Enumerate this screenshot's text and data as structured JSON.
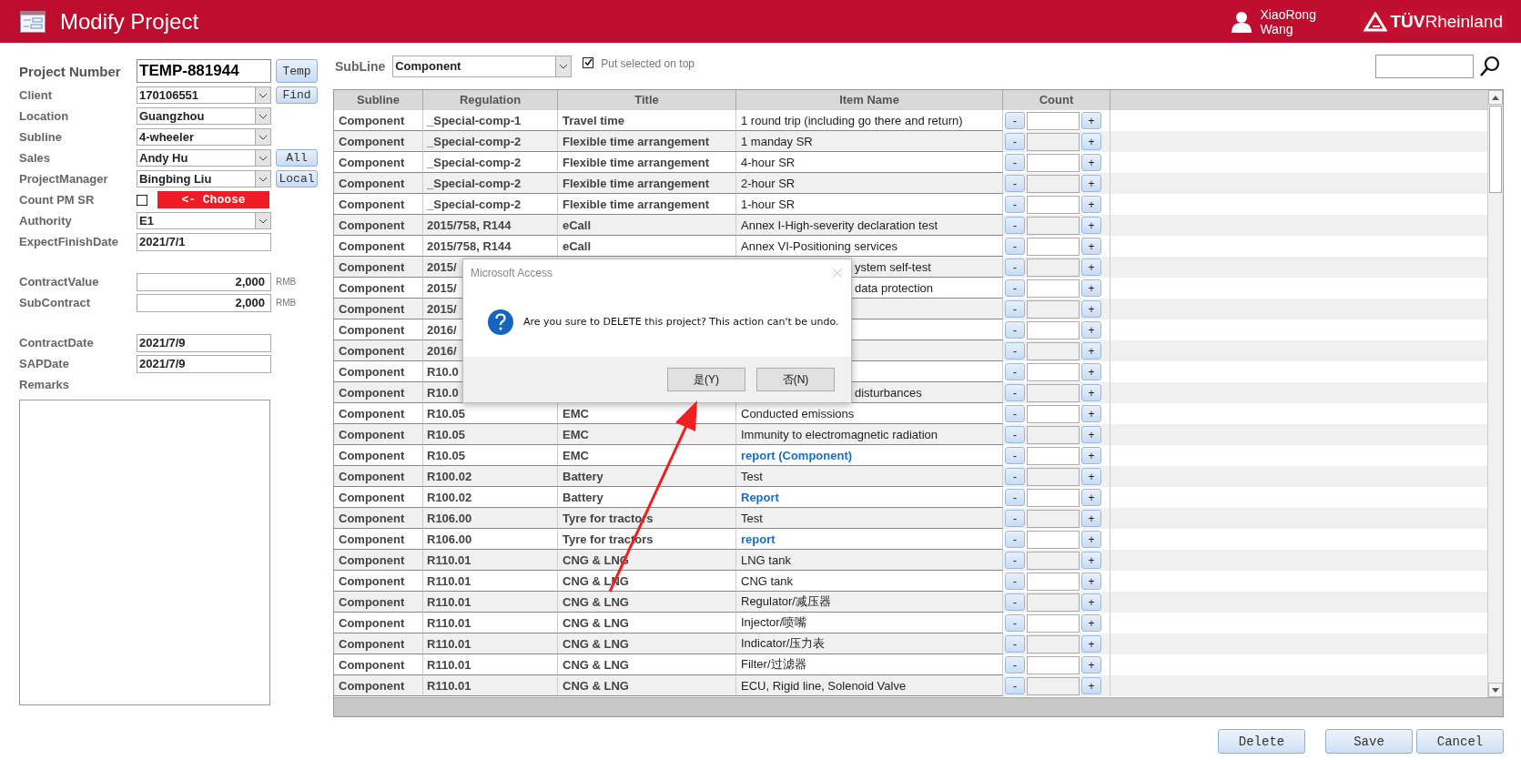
{
  "window": {
    "title": "Modify Project"
  },
  "user": {
    "name": "XiaoRong Wang"
  },
  "logo": {
    "text": "**TÜV**Rheinland"
  },
  "form": {
    "groups": [
      [
        {
          "label": "Project Number",
          "kind": "big",
          "value": "TEMP-881944",
          "button": {
            "label": "Temp",
            "kind": "plain"
          }
        },
        {
          "label": "Client",
          "kind": "combo",
          "value": "170106551",
          "button": {
            "label": "Find",
            "kind": "plain"
          }
        },
        {
          "label": "Location",
          "kind": "combo",
          "value": "Guangzhou"
        },
        {
          "label": "Subline",
          "kind": "combo",
          "value": "4-wheeler"
        },
        {
          "label": "Sales",
          "kind": "combo",
          "value": "Andy Hu",
          "button": {
            "label": "All",
            "kind": "plain"
          }
        },
        {
          "label": "ProjectManager",
          "kind": "combo",
          "value": "Bingbing Liu",
          "button": {
            "label": "Local",
            "kind": "plain"
          }
        },
        {
          "label": "Count PM SR",
          "kind": "checkbox",
          "checked": false,
          "button": {
            "label": "<- Choose",
            "kind": "alert"
          }
        },
        {
          "label": "Authority",
          "kind": "combo",
          "value": "E1"
        },
        {
          "label": "ExpectFinishDate",
          "kind": "text",
          "value": "2021/7/1"
        }
      ],
      [
        {
          "label": "ContractValue",
          "kind": "number",
          "value": "2,000",
          "unit": "RMB"
        },
        {
          "label": "SubContract",
          "kind": "number",
          "value": "2,000",
          "unit": "RMB"
        }
      ],
      [
        {
          "label": "ContractDate",
          "kind": "text",
          "value": "2021/7/9"
        },
        {
          "label": "SAPDate",
          "kind": "text",
          "value": "2021/7/9"
        },
        {
          "label": "Remarks",
          "kind": "area"
        }
      ]
    ]
  },
  "subline_filter": {
    "label": "SubLine",
    "value": "Component"
  },
  "put_selected_on_top": {
    "label": "Put selected on top",
    "checked": true
  },
  "table": {
    "columns": [
      "Subline",
      "Regulation",
      "Title",
      "Item Name",
      "Count"
    ],
    "rows": [
      {
        "kind": "full",
        "subline": "Component",
        "regulation": "_Special-comp-1",
        "title": "Travel time",
        "item": "1 round trip (including go there and return)",
        "item_link": false,
        "minus": "-",
        "plus": "+"
      },
      {
        "kind": "full",
        "subline": "Component",
        "regulation": "_Special-comp-2",
        "title": "Flexible time arrangement",
        "item": "1 manday SR",
        "item_link": false,
        "minus": "-",
        "plus": "+"
      },
      {
        "kind": "full",
        "subline": "Component",
        "regulation": "_Special-comp-2",
        "title": "Flexible time arrangement",
        "item": "4-hour SR",
        "item_link": false,
        "minus": "-",
        "plus": "+"
      },
      {
        "kind": "full",
        "subline": "Component",
        "regulation": "_Special-comp-2",
        "title": "Flexible time arrangement",
        "item": "2-hour SR",
        "item_link": false,
        "minus": "-",
        "plus": "+"
      },
      {
        "kind": "full",
        "subline": "Component",
        "regulation": "_Special-comp-2",
        "title": "Flexible time arrangement",
        "item": "1-hour SR",
        "item_link": false,
        "minus": "-",
        "plus": "+"
      },
      {
        "kind": "full",
        "subline": "Component",
        "regulation": "2015/758, R144",
        "title": "eCall",
        "item": "Annex I-High-severity declaration test",
        "item_link": false,
        "minus": "-",
        "plus": "+"
      },
      {
        "kind": "full",
        "subline": "Component",
        "regulation": "2015/758, R144",
        "title": "eCall",
        "item": "Annex VI-Positioning services",
        "item_link": false,
        "minus": "-",
        "plus": "+"
      },
      {
        "kind": "covered",
        "subline": "Component",
        "regulation": "2015/",
        "item": "ystem self-test",
        "item_link": false,
        "minus": "-",
        "plus": "+"
      },
      {
        "kind": "covered",
        "subline": "Component",
        "regulation": "2015/",
        "item": "data protection",
        "item_link": false,
        "minus": "-",
        "plus": "+"
      },
      {
        "kind": "covered",
        "subline": "Component",
        "regulation": "2015/",
        "minus": "-",
        "plus": "+"
      },
      {
        "kind": "covered",
        "subline": "Component",
        "regulation": "2016/",
        "minus": "-",
        "plus": "+"
      },
      {
        "kind": "covered",
        "subline": "Component",
        "regulation": "2016/",
        "minus": "-",
        "plus": "+"
      },
      {
        "kind": "covered",
        "subline": "Component",
        "regulation": "R10.0",
        "minus": "-",
        "plus": "+"
      },
      {
        "kind": "covered",
        "subline": "Component",
        "regulation": "R10.0",
        "item": "disturbances",
        "item_link": false,
        "minus": "-",
        "plus": "+"
      },
      {
        "kind": "full",
        "subline": "Component",
        "regulation": "R10.05",
        "title": "EMC",
        "item": "Conducted emissions",
        "item_link": false,
        "minus": "-",
        "plus": "+"
      },
      {
        "kind": "full",
        "subline": "Component",
        "regulation": "R10.05",
        "title": "EMC",
        "item": "Immunity to electromagnetic radiation",
        "item_link": false,
        "minus": "-",
        "plus": "+"
      },
      {
        "kind": "full",
        "subline": "Component",
        "regulation": "R10.05",
        "title": "EMC",
        "item": "report (Component)",
        "item_link": true,
        "minus": "-",
        "plus": "+"
      },
      {
        "kind": "full",
        "subline": "Component",
        "regulation": "R100.02",
        "title": "Battery",
        "item": "Test",
        "item_link": false,
        "minus": "-",
        "plus": "+"
      },
      {
        "kind": "full",
        "subline": "Component",
        "regulation": "R100.02",
        "title": "Battery",
        "item": "Report",
        "item_link": true,
        "minus": "-",
        "plus": "+"
      },
      {
        "kind": "full",
        "subline": "Component",
        "regulation": "R106.00",
        "title": "Tyre for tractors",
        "item": "Test",
        "item_link": false,
        "minus": "-",
        "plus": "+"
      },
      {
        "kind": "full",
        "subline": "Component",
        "regulation": "R106.00",
        "title": "Tyre for tractors",
        "item": "report",
        "item_link": true,
        "minus": "-",
        "plus": "+"
      },
      {
        "kind": "full",
        "subline": "Component",
        "regulation": "R110.01",
        "title": "CNG & LNG",
        "item": "LNG tank",
        "item_link": false,
        "minus": "-",
        "plus": "+"
      },
      {
        "kind": "full",
        "subline": "Component",
        "regulation": "R110.01",
        "title": "CNG & LNG",
        "item": "CNG tank",
        "item_link": false,
        "minus": "-",
        "plus": "+"
      },
      {
        "kind": "full",
        "subline": "Component",
        "regulation": "R110.01",
        "title": "CNG & LNG",
        "item": "Regulator/减压器",
        "item_link": false,
        "minus": "-",
        "plus": "+"
      },
      {
        "kind": "full",
        "subline": "Component",
        "regulation": "R110.01",
        "title": "CNG & LNG",
        "item": "Injector/喷嘴",
        "item_link": false,
        "minus": "-",
        "plus": "+"
      },
      {
        "kind": "full",
        "subline": "Component",
        "regulation": "R110.01",
        "title": "CNG & LNG",
        "item": "Indicator/压力表",
        "item_link": false,
        "minus": "-",
        "plus": "+"
      },
      {
        "kind": "full",
        "subline": "Component",
        "regulation": "R110.01",
        "title": "CNG & LNG",
        "item": "Filter/过滤器",
        "item_link": false,
        "minus": "-",
        "plus": "+"
      },
      {
        "kind": "full",
        "subline": "Component",
        "regulation": "R110.01",
        "title": "CNG & LNG",
        "item": "ECU, Rigid line, Solenoid Valve",
        "item_link": false,
        "minus": "-",
        "plus": "+"
      }
    ]
  },
  "dialog": {
    "title": "Microsoft Access",
    "message": "Are you sure to DELETE this project? This action can't be undo.",
    "buttons": [
      "是(Y)",
      "否(N)"
    ]
  },
  "footer_buttons": [
    "Delete",
    "Save",
    "Cancel"
  ]
}
